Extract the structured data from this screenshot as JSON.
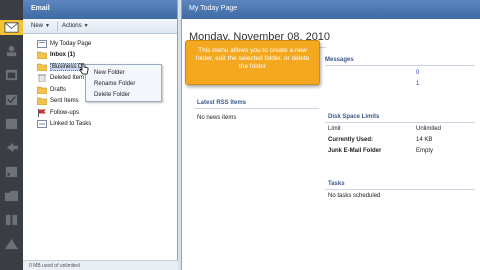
{
  "email_panel": {
    "title": "Email",
    "toolbar": {
      "new_label": "New",
      "actions_label": "Actions"
    },
    "folders": [
      {
        "label": "My Today Page",
        "icon": "today-icon"
      },
      {
        "label": "Inbox (1)",
        "icon": "folder-icon",
        "bold": true
      },
      {
        "label": "Business D",
        "icon": "folder-icon",
        "selected": true
      },
      {
        "label": "Deleted Item",
        "icon": "trash-icon"
      },
      {
        "label": "Drafts",
        "icon": "folder-icon"
      },
      {
        "label": "Sent Items",
        "icon": "folder-icon"
      },
      {
        "label": "Follow-ups",
        "icon": "flag-icon"
      },
      {
        "label": "Linked to Tasks",
        "icon": "link-icon"
      }
    ],
    "footer": "0 MB used of unlimited"
  },
  "context_menu": {
    "items": [
      "New Folder",
      "Rename Folder",
      "Delete Folder"
    ]
  },
  "today_page": {
    "title": "My Today Page",
    "date": "Monday, November 08, 2010",
    "messages_title": "Messages",
    "messages_values": [
      "0",
      "1"
    ],
    "rss_title": "Latest RSS Items",
    "rss_empty": "No news items",
    "disk_title": "Disk Space Limits",
    "disk_rows": [
      {
        "label": "Limit",
        "value": "Unlimited",
        "bold": false
      },
      {
        "label": "Currently Used:",
        "value": "14 KB",
        "bold": true
      },
      {
        "label": "Junk E-Mail Folder",
        "value": "Empty",
        "bold": true
      }
    ],
    "tasks_title": "Tasks",
    "tasks_empty": "No tasks scheduled"
  },
  "tooltip": {
    "text": "This menu allows you to create a new folder, edit the selected folder, or delete the folder"
  },
  "colors": {
    "header_blue": "#4a76b0",
    "tooltip_orange": "#f3a820",
    "rail_dark": "#3a3d42",
    "rail_active": "#f2c335"
  },
  "rail_icons": [
    "mail-icon",
    "contacts-icon",
    "calendar-icon",
    "tasks-icon",
    "notes-icon",
    "back-icon",
    "feeds-icon",
    "files-icon",
    "documents-icon",
    "alerts-icon"
  ]
}
